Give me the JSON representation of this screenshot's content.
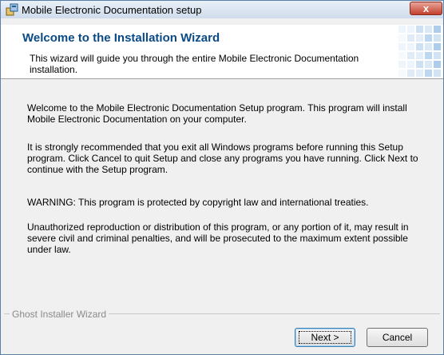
{
  "window": {
    "title": "Mobile Electronic Documentation setup",
    "close_label": "x"
  },
  "header": {
    "title": "Welcome to the Installation Wizard",
    "subtitle": "This wizard will guide you through the entire Mobile Electronic Documentation installation."
  },
  "body": {
    "paragraphs": [
      "Welcome to the Mobile Electronic Documentation Setup program. This program will install Mobile Electronic Documentation on your computer.",
      "It is strongly recommended that you exit all Windows programs before running this Setup program. Click Cancel to quit Setup and close any programs you have running. Click Next to continue with the Setup program.",
      "WARNING: This program is protected by copyright law and international treaties.",
      "Unauthorized reproduction or distribution of this program, or any portion of it, may result in severe civil and criminal penalties, and will be prosecuted to the maximum extent possible under law."
    ]
  },
  "footer": {
    "brand": "Ghost Installer Wizard",
    "next_label": "Next >",
    "cancel_label": "Cancel"
  },
  "colors": {
    "header_title": "#0a4a86",
    "grid_decoration": "#9dc3e8",
    "close_button": "#c2402c"
  },
  "icons": {
    "app": "installer-icon",
    "close": "close-icon",
    "decoration": "grid-decoration-icon"
  }
}
